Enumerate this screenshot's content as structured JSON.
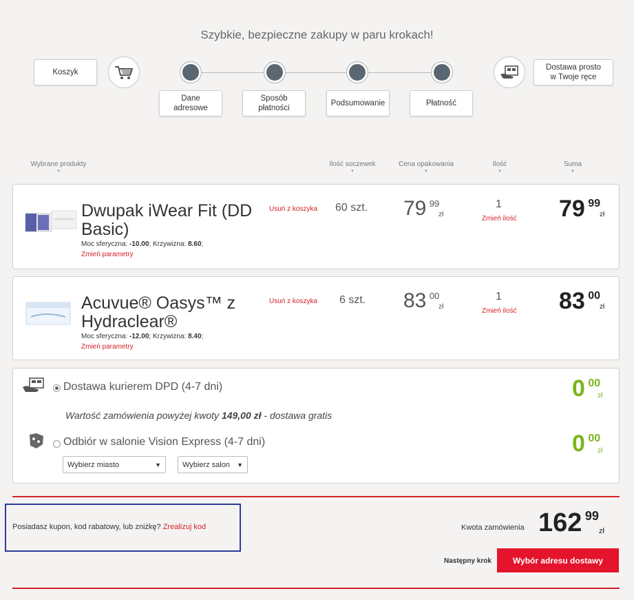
{
  "header": {
    "tagline": "Szybkie, bezpieczne zakupy w paru krokach!",
    "cart_label": "Koszyk",
    "delivery_label_line1": "Dostawa prosto",
    "delivery_label_line2": "w Twoje ręce"
  },
  "steps": [
    {
      "line1": "Dane",
      "line2": "adresowe"
    },
    {
      "line1": "Sposób",
      "line2": "płatności"
    },
    {
      "line1": "Podsumowanie",
      "line2": ""
    },
    {
      "line1": "Płatność",
      "line2": ""
    }
  ],
  "columns": {
    "products": "Wybrane produkty",
    "lens_count": "Ilość soczewek",
    "package_price": "Cena opakowania",
    "quantity": "Ilość",
    "sum": "Suma"
  },
  "products": [
    {
      "name_line1": "Dwupak iWear Fit (DD",
      "name_line2": "Basic)",
      "params_label1": "Moc sferyczna: ",
      "params_value1": "-10.00",
      "params_label2": "; Krzywizna: ",
      "params_value2": "8.60",
      "params_end": ";",
      "change_params": "Zmień parametry",
      "remove": "Usuń z koszyka",
      "lens_count": "60 szt.",
      "price_int": "79",
      "price_dec": "99",
      "currency": "zł",
      "qty": "1",
      "change_qty": "Zmień ilość",
      "sum_int": "79",
      "sum_dec": "99"
    },
    {
      "name_line1": "Acuvue® Oasys™ z",
      "name_line2": "Hydraclear®",
      "params_label1": "Moc sferyczna: ",
      "params_value1": "-12.00",
      "params_label2": "; Krzywizna: ",
      "params_value2": "8.40",
      "params_end": ";",
      "change_params": "Zmień parametry",
      "remove": "Usuń z koszyka",
      "lens_count": "6 szt.",
      "price_int": "83",
      "price_dec": "00",
      "currency": "zł",
      "qty": "1",
      "change_qty": "Zmień ilość",
      "sum_int": "83",
      "sum_dec": "00"
    }
  ],
  "shipping": {
    "courier_label": "Dostawa kurierem DPD (4-7 dni)",
    "courier_price_int": "0",
    "courier_price_dec": "00",
    "free_note_pre": "Wartość zamówienia powyżej kwoty ",
    "free_note_amount": "149,00 zł",
    "free_note_post": " - dostawa gratis",
    "salon_label": "Odbiór w salonie Vision Express (4-7 dni)",
    "salon_price_int": "0",
    "salon_price_dec": "00",
    "currency": "zł",
    "city_select": "Wybierz miasto",
    "salon_select": "Wybierz salon"
  },
  "footer": {
    "coupon_text": "Posiadasz kupon, kod rabatowy, lub zniżkę? ",
    "coupon_link": "Zrealizuj kod",
    "total_label": "Kwota zamówienia",
    "total_int": "162",
    "total_dec": "99",
    "currency": "zł",
    "next_step_label": "Następny krok",
    "cta_label": "Wybór adresu dostawy"
  },
  "colors": {
    "accent_red": "#e3142b",
    "link_red": "#d42127",
    "free_green": "#7ab51d",
    "step_dot": "#5b6770",
    "coupon_border": "#2e3a9a"
  }
}
